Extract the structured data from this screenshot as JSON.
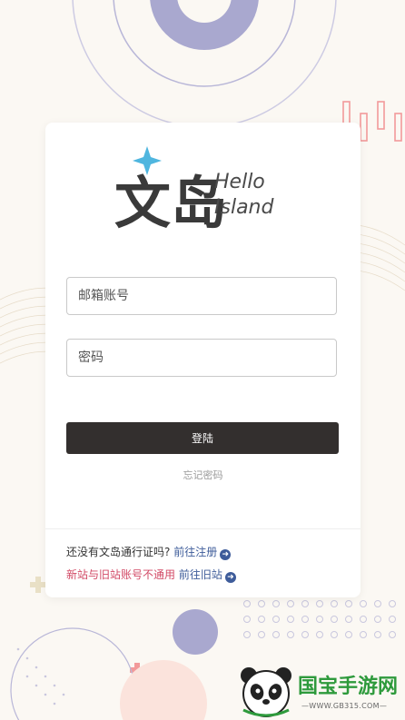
{
  "logo": {
    "brand_text": "文岛",
    "hello_text": "Hello",
    "island_text": "Island"
  },
  "form": {
    "email_placeholder": "邮箱账号",
    "password_placeholder": "密码",
    "login_label": "登陆",
    "forgot_label": "忘记密码"
  },
  "footer": {
    "no_pass_text": "还没有文岛通行证吗?",
    "register_link": "前往注册",
    "notice_text": "新站与旧站账号不通用",
    "old_site_link": "前往旧站"
  },
  "watermark": {
    "title": "国宝手游网",
    "url": "—WWW.GB315.COM—"
  },
  "colors": {
    "button_bg": "#332f2e",
    "link": "#3e5c9a",
    "notice": "#d24a66",
    "logo_blue": "#4fb6df",
    "decor_purple": "#a9a8cf",
    "decor_pink": "#f29a9a"
  }
}
